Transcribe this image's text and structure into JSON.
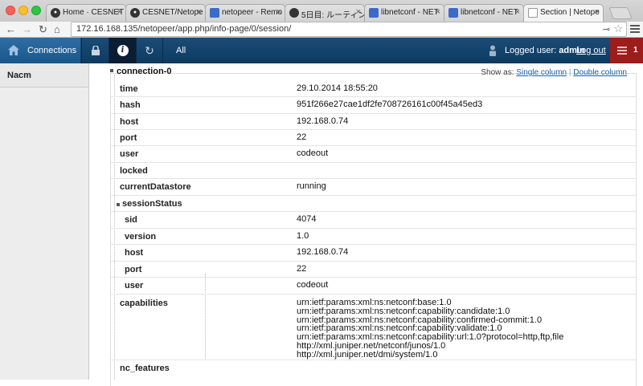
{
  "browser": {
    "tabs": [
      {
        "title": "Home · CESNET",
        "favicon": "github-icon"
      },
      {
        "title": "CESNET/Netope",
        "favicon": "github-icon"
      },
      {
        "title": "netopeer - Remo",
        "favicon": "php-icon"
      },
      {
        "title": "5日目: ルーティン",
        "favicon": "site-icon"
      },
      {
        "title": "libnetconf - NET",
        "favicon": "php-icon"
      },
      {
        "title": "libnetconf - NET",
        "favicon": "php-icon"
      },
      {
        "title": "Section | Netope",
        "favicon": "page-icon"
      }
    ],
    "url": "172.16.168.135/netopeer/app.php/info-page/0/session/"
  },
  "nav": {
    "connections": "Connections",
    "all": "All",
    "logged_user_label": "Logged user:",
    "logged_user_name": "admin",
    "logout": "Log out",
    "alert_count": "1"
  },
  "sidebar": {
    "items": [
      {
        "label": "Nacm"
      }
    ]
  },
  "tree": {
    "root": "connection-0",
    "show_as": {
      "label": "Show as:",
      "single": "Single column",
      "double": "Double column",
      "sep": "|"
    },
    "rows": [
      {
        "key": "time",
        "value": "29.10.2014 18:55:20"
      },
      {
        "key": "hash",
        "value": "951f266e27cae1df2fe708726161c00f45a45ed3"
      },
      {
        "key": "host",
        "value": "192.168.0.74"
      },
      {
        "key": "port",
        "value": "22"
      },
      {
        "key": "user",
        "value": "codeout"
      },
      {
        "key": "locked",
        "value": ""
      },
      {
        "key": "currentDatastore",
        "value": "running"
      },
      {
        "key": "sessionStatus",
        "value": ""
      },
      {
        "key": "sid",
        "value": "4074"
      },
      {
        "key": "version",
        "value": "1.0"
      },
      {
        "key": "host",
        "value": "192.168.0.74"
      },
      {
        "key": "port",
        "value": "22"
      },
      {
        "key": "user",
        "value": "codeout"
      },
      {
        "key": "capabilities",
        "value": "urn:ietf:params:xml:ns:netconf:base:1.0\nurn:ietf:params:xml:ns:netconf:capability:candidate:1.0\nurn:ietf:params:xml:ns:netconf:capability:confirmed-commit:1.0\nurn:ietf:params:xml:ns:netconf:capability:validate:1.0\nurn:ietf:params:xml:ns:netconf:capability:url:1.0?protocol=http,ftp,file\nhttp://xml.juniper.net/netconf/junos/1.0\nhttp://xml.juniper.net/dmi/system/1.0"
      },
      {
        "key": "nc_features",
        "value": ""
      }
    ]
  },
  "colors": {
    "nav_bg": "#0d3a60",
    "connections_bg": "#2e6da4",
    "alert_bg": "#9d1c1c",
    "link": "#1e5fa7"
  }
}
